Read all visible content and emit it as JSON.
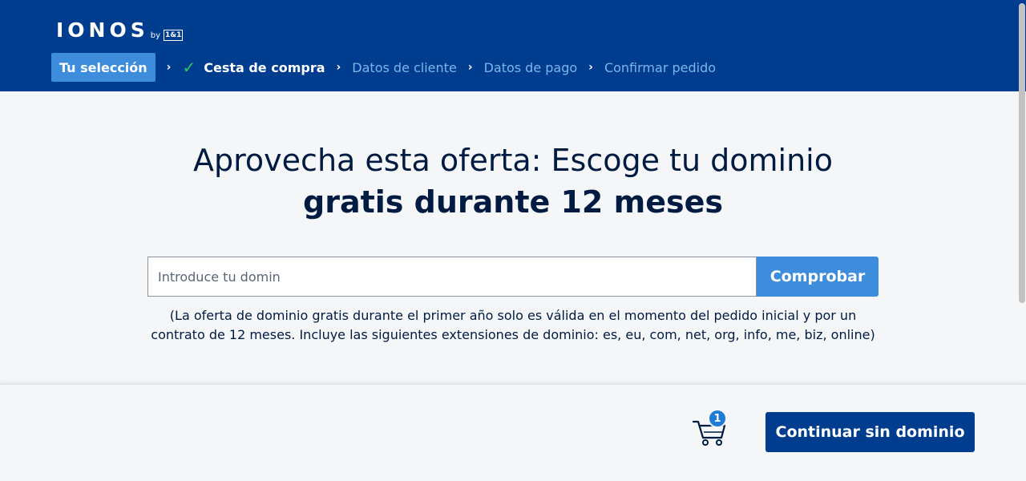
{
  "header": {
    "logo": {
      "main": "IONOS",
      "by": "by",
      "brand": "1&1"
    },
    "steps": {
      "current": "Tu selección",
      "done": "Cesta de compra",
      "next1": "Datos de cliente",
      "next2": "Datos de pago",
      "next3": "Confirmar pedido",
      "separator": "›",
      "check": "✓"
    }
  },
  "main": {
    "headline_line1": "Aprovecha esta oferta: Escoge tu dominio",
    "headline_line2": "gratis durante 12 meses",
    "search": {
      "placeholder": "Introduce tu domin",
      "value": "",
      "button_label": "Comprobar"
    },
    "disclaimer": "(La oferta de dominio gratis durante el primer año solo es válida en el momento del pedido inicial y por un contrato de 12 meses. Incluye las siguientes extensiones de dominio: es, eu, com, net, org, info, me, biz, online)"
  },
  "footer": {
    "cart_icon": "shopping-cart-icon",
    "cart_count": "1",
    "continue_label": "Continuar sin dominio"
  },
  "colors": {
    "header_bg": "#003d8f",
    "accent": "#3e8ddd",
    "check_green": "#2cc866",
    "text_dark": "#001b41",
    "page_bg": "#f4f6f8"
  }
}
